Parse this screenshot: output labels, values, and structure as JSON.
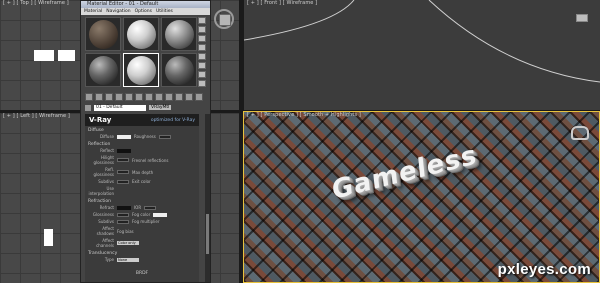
{
  "viewports": {
    "top_label": "[ + ] [ Top ] [ Wireframe ]",
    "front_label": "[ + ] [ Front ] [ Wireframe ]",
    "left_label": "[ + ] [ Left ] [ Wireframe ]",
    "persp_label": "[ + ] [ Perspective ] [ Smooth + Highlights ]"
  },
  "scene": {
    "text_object": "Gameless",
    "watermark": "pxleyes.com"
  },
  "material_editor": {
    "title": "Material Editor - 01 - Default",
    "menu": [
      "Material",
      "Navigation",
      "Options",
      "Utilities"
    ],
    "material_name": "01 - Default",
    "material_type": "VRayMtl",
    "vray_logo": "V-Ray",
    "vray_tagline": "optimized for V-Ray",
    "sections": {
      "diffuse": "Diffuse",
      "reflection": "Reflection",
      "refraction": "Refraction",
      "translucency": "Translucency",
      "brdf": "BRDF"
    },
    "fields": {
      "diffuse": "Diffuse",
      "roughness": "Roughness",
      "reflect": "Reflect",
      "hilight_gloss": "Hilight glossiness",
      "refl_gloss": "Refl. glossiness",
      "fresnel": "Fresnel reflections",
      "subdivs": "Subdivs",
      "max_depth": "Max depth",
      "use_interp": "Use interpolation",
      "exit_color": "Exit color",
      "refract": "Refract",
      "ior": "IOR",
      "glossiness": "Glossiness",
      "fog_color": "Fog color",
      "fog_mult": "Fog multiplier",
      "affect_shadows": "Affect shadows",
      "fog_bias": "Fog bias",
      "affect_channels": "Affect channels",
      "color_only": "Color only",
      "type": "Type",
      "none": "None"
    }
  }
}
